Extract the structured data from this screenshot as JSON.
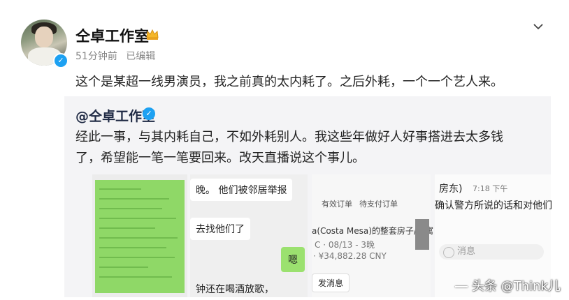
{
  "post": {
    "author": "仝卓工作室",
    "time": "51分钟前",
    "edited": "已编辑",
    "text": "这个是某超一线男演员，我之前真的太内耗了。之后外耗，一个一个艺人来。"
  },
  "repost": {
    "author": "@仝卓工作室",
    "text": "经此一事，与其内耗自己，不如外耗别人。我这些年做好人好事搭进去太多钱了，希望能一笔一笔要回来。改天直播说这个事儿。"
  },
  "screenshot2": {
    "msg1": "晚。      他们被邻居举报",
    "msg2": "去找他们了",
    "msg3": "嗯",
    "msg4": "钟还在喝酒放歌，"
  },
  "screenshot3": {
    "tab1": "有效订单",
    "tab2": "待支付订单",
    "listing": "a(Costa Mesa)的整套房子/公寓",
    "dates": "C · 08/13 - 3晚",
    "price": "· ¥34,882.28 CNY",
    "button": "发消息"
  },
  "screenshot4": {
    "title": "房东)",
    "time": "7:18 下午",
    "message": "确认警方所说的话和对他们",
    "input_placeholder": "消息"
  },
  "watermark": "头条 @Think儿",
  "colors": {
    "verified": "#1da1f2",
    "chat_green": "#9be16f",
    "repost_bg": "#f4f4f6"
  },
  "icons": {
    "verified": "verified-badge-icon",
    "crown": "crown-icon",
    "more": "chevron-down-icon"
  }
}
